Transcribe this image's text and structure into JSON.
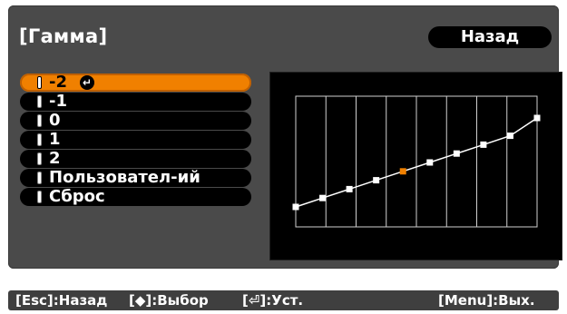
{
  "title": "[Гамма]",
  "back_button": "Назад",
  "menu": [
    {
      "label": "-2",
      "selected": true
    },
    {
      "label": "-1",
      "selected": false
    },
    {
      "label": "0",
      "selected": false
    },
    {
      "label": "1",
      "selected": false
    },
    {
      "label": "2",
      "selected": false
    },
    {
      "label": "Пользовател-ий",
      "selected": false
    },
    {
      "label": "Сброс",
      "selected": false
    }
  ],
  "enter_icon": "enter-icon",
  "graph": {
    "points": [
      0.0,
      0.1,
      0.2,
      0.3,
      0.4,
      0.5,
      0.6,
      0.7,
      0.8,
      1.0
    ],
    "highlighted_index": 4,
    "colors": {
      "line": "#ffffff",
      "point": "#ffffff",
      "highlight": "#f08000",
      "grid": "#cfcfcf"
    }
  },
  "footer": {
    "esc": "[Esc]:Назад",
    "select": "[◆]:Выбор",
    "set": "[⏎]:Уст.",
    "menu": "[Menu]:Вых."
  },
  "colors": {
    "accent": "#f08000",
    "panel": "#4a4a4a",
    "item_bg": "#000000"
  }
}
